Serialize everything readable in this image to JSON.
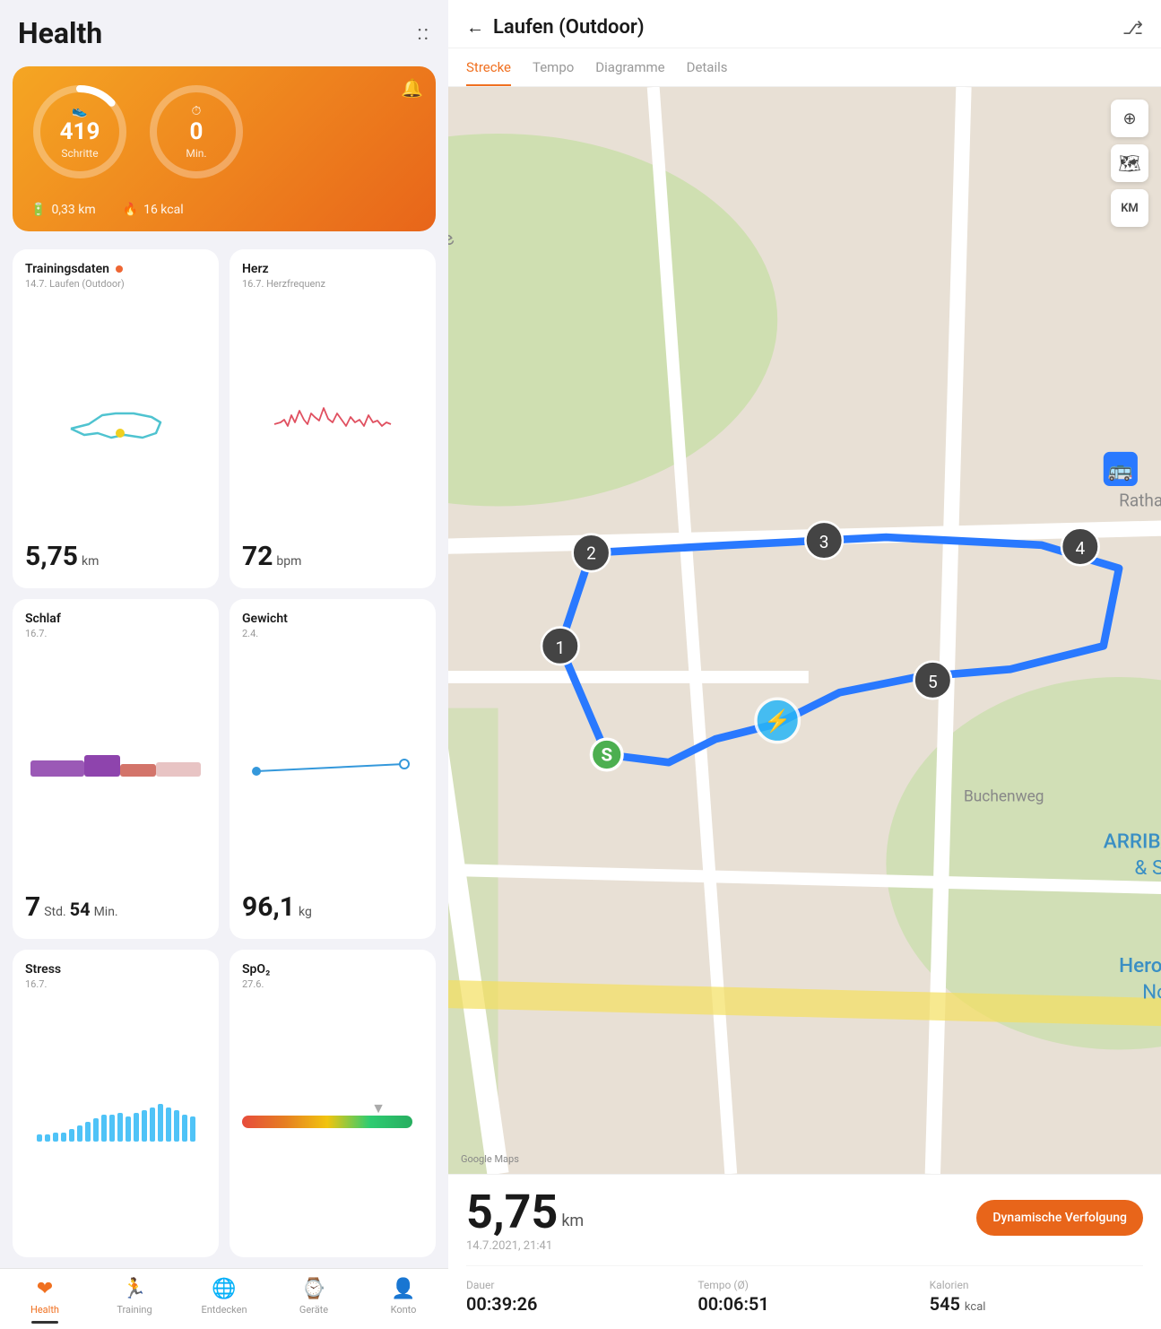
{
  "left": {
    "header": {
      "title": "Health",
      "menu_icon": "::"
    },
    "orange_card": {
      "steps_value": "419",
      "steps_label": "Schritte",
      "time_value": "0",
      "time_label": "Min.",
      "distance": "0,33 km",
      "calories": "16 kcal"
    },
    "cards": [
      {
        "id": "training",
        "title": "Trainingsdaten",
        "has_dot": true,
        "subtitle": "14.7. Laufen (Outdoor)",
        "value": "5,75",
        "unit": "km"
      },
      {
        "id": "herz",
        "title": "Herz",
        "has_dot": false,
        "subtitle": "16.7. Herzfrequenz",
        "value": "72",
        "unit": "bpm"
      },
      {
        "id": "schlaf",
        "title": "Schlaf",
        "has_dot": false,
        "subtitle": "16.7.",
        "value": "7",
        "unit": "Std.",
        "value2": "54",
        "unit2": "Min."
      },
      {
        "id": "gewicht",
        "title": "Gewicht",
        "has_dot": false,
        "subtitle": "2.4.",
        "value": "96,1",
        "unit": "kg"
      },
      {
        "id": "stress",
        "title": "Stress",
        "has_dot": false,
        "subtitle": "16.7.",
        "value": "",
        "unit": ""
      },
      {
        "id": "spo2",
        "title": "SpO₂",
        "has_dot": false,
        "subtitle": "27.6.",
        "value": "",
        "unit": ""
      }
    ],
    "bottom_nav": [
      {
        "id": "health",
        "label": "Health",
        "active": true
      },
      {
        "id": "training",
        "label": "Training",
        "active": false
      },
      {
        "id": "entdecken",
        "label": "Entdecken",
        "active": false
      },
      {
        "id": "geraete",
        "label": "Geräte",
        "active": false
      },
      {
        "id": "konto",
        "label": "Konto",
        "active": false
      }
    ]
  },
  "right": {
    "header": {
      "back_label": "←",
      "title": "Laufen (Outdoor)"
    },
    "tabs": [
      {
        "id": "strecke",
        "label": "Strecke",
        "active": true
      },
      {
        "id": "tempo",
        "label": "Tempo",
        "active": false
      },
      {
        "id": "diagramme",
        "label": "Diagramme",
        "active": false
      },
      {
        "id": "details",
        "label": "Details",
        "active": false
      }
    ],
    "map_controls": {
      "location_icon": "⊕",
      "map_icon": "🗺",
      "unit_label": "KM"
    },
    "stats": {
      "distance_value": "5,75",
      "distance_unit": "km",
      "date": "14.7.2021, 21:41",
      "dynamic_btn_label": "Dynamische Verfolgung",
      "dauer_label": "Dauer",
      "dauer_value": "00:39:26",
      "tempo_label": "Tempo (Ø)",
      "tempo_value": "00:06:51",
      "kalorien_label": "Kalorien",
      "kalorien_value": "545",
      "kalorien_unit": "kcal",
      "google_maps_label": "Google Maps"
    }
  }
}
